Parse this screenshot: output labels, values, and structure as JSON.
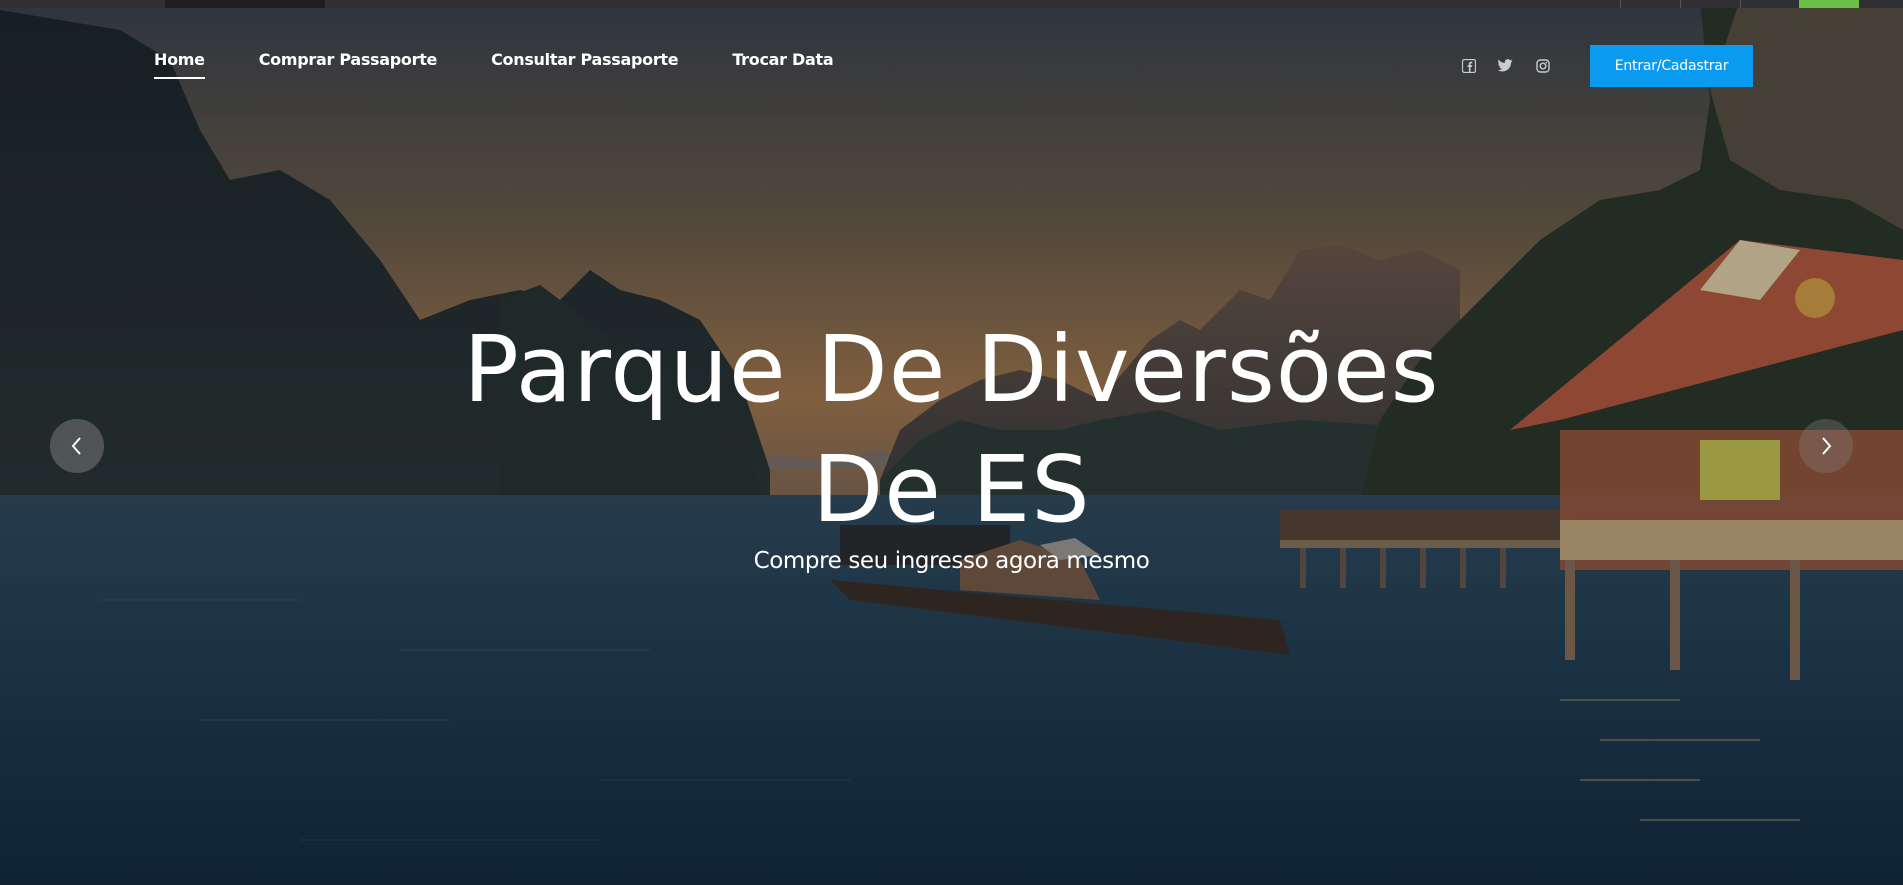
{
  "nav": {
    "items": [
      {
        "label": "Home",
        "active": true
      },
      {
        "label": "Comprar Passaporte",
        "active": false
      },
      {
        "label": "Consultar Passaporte",
        "active": false
      },
      {
        "label": "Trocar Data",
        "active": false
      }
    ]
  },
  "social": {
    "icons": [
      "facebook-icon",
      "twitter-icon",
      "instagram-icon"
    ]
  },
  "header": {
    "login_label": "Entrar/Cadastrar"
  },
  "hero": {
    "title_line1": "Parque De Diversões",
    "title_line2": "De ES",
    "subtitle": "Compre seu ingresso agora mesmo"
  },
  "carousel": {
    "prev_icon": "chevron-left-icon",
    "next_icon": "chevron-right-icon"
  },
  "colors": {
    "accent": "#0a9bf0",
    "top_indicator": "#6cc04a"
  }
}
